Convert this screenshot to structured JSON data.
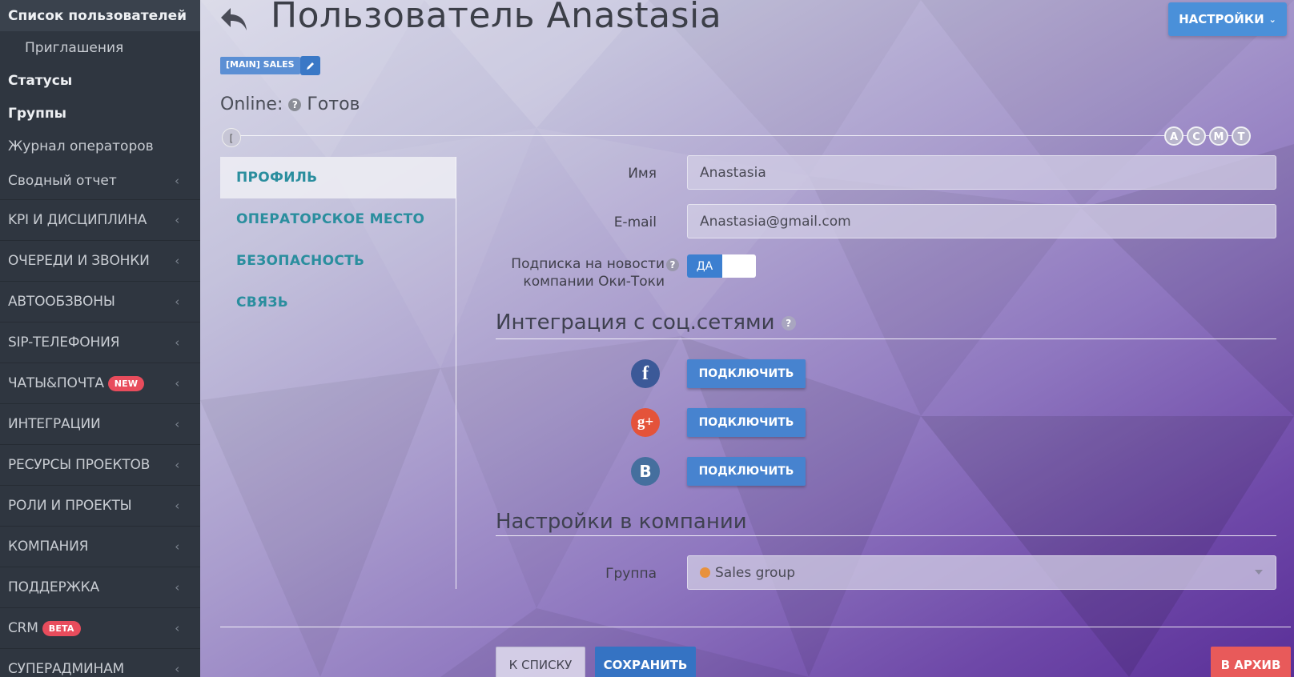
{
  "sidebar": {
    "items": [
      {
        "label": "Список пользователей"
      },
      {
        "label": "Приглашения"
      },
      {
        "label": "Статусы"
      },
      {
        "label": "Группы"
      },
      {
        "label": "Журнал операторов"
      },
      {
        "label": "Сводный отчет"
      },
      {
        "label": "KPI И ДИСЦИПЛИНА"
      },
      {
        "label": "ОЧЕРЕДИ И ЗВОНКИ"
      },
      {
        "label": "АВТООБЗВОНЫ"
      },
      {
        "label": "SIP-ТЕЛЕФОНИЯ"
      },
      {
        "label": "ЧАТЫ&ПОЧТА",
        "badge": "NEW"
      },
      {
        "label": "ИНТЕГРАЦИИ"
      },
      {
        "label": "РЕСУРСЫ ПРОЕКТОВ"
      },
      {
        "label": "РОЛИ И ПРОЕКТЫ"
      },
      {
        "label": "КОМПАНИЯ"
      },
      {
        "label": "ПОДДЕРЖКА"
      },
      {
        "label": "CRM",
        "badge": "BETA"
      },
      {
        "label": "СУПЕРАДМИНАМ"
      }
    ]
  },
  "header": {
    "title": "Пользователь Anastasia",
    "settings_label": "НАСТРОЙКИ",
    "tag": "[MAIN] SALES",
    "online_label": "Online:",
    "online_status": "Готов"
  },
  "timeline": {
    "start": "[",
    "markers": [
      "A",
      "C",
      "M",
      "T"
    ]
  },
  "tabs": [
    {
      "label": "ПРОФИЛЬ",
      "active": true
    },
    {
      "label": "ОПЕРАТОРСКОЕ МЕСТО"
    },
    {
      "label": "БЕЗОПАСНОСТЬ"
    },
    {
      "label": "СВЯЗЬ"
    }
  ],
  "profile": {
    "name_label": "Имя",
    "name_value": "Anastasia",
    "email_label": "E-mail",
    "email_value": "Anastasia@gmail.com",
    "subscription_label_1": "Подписка на новости",
    "subscription_label_2": "компании Оки-Токи",
    "subscription_value": "ДА"
  },
  "social": {
    "title": "Интеграция с соц.сетями",
    "networks": [
      {
        "name": "facebook-icon",
        "glyph": "f",
        "color": "#3b5998",
        "button": "ПОДКЛЮЧИТЬ"
      },
      {
        "name": "google-plus-icon",
        "glyph": "g+",
        "color": "#e4533a",
        "button": "ПОДКЛЮЧИТЬ"
      },
      {
        "name": "vk-icon",
        "glyph": "B",
        "color": "#456f9e",
        "button": "ПОДКЛЮЧИТЬ"
      }
    ]
  },
  "company": {
    "title": "Настройки в компании",
    "group_label": "Группа",
    "group_value": "Sales group"
  },
  "actions": {
    "back_to_list": "К СПИСКУ",
    "save": "СОХРАНИТЬ",
    "archive": "В АРХИВ"
  }
}
